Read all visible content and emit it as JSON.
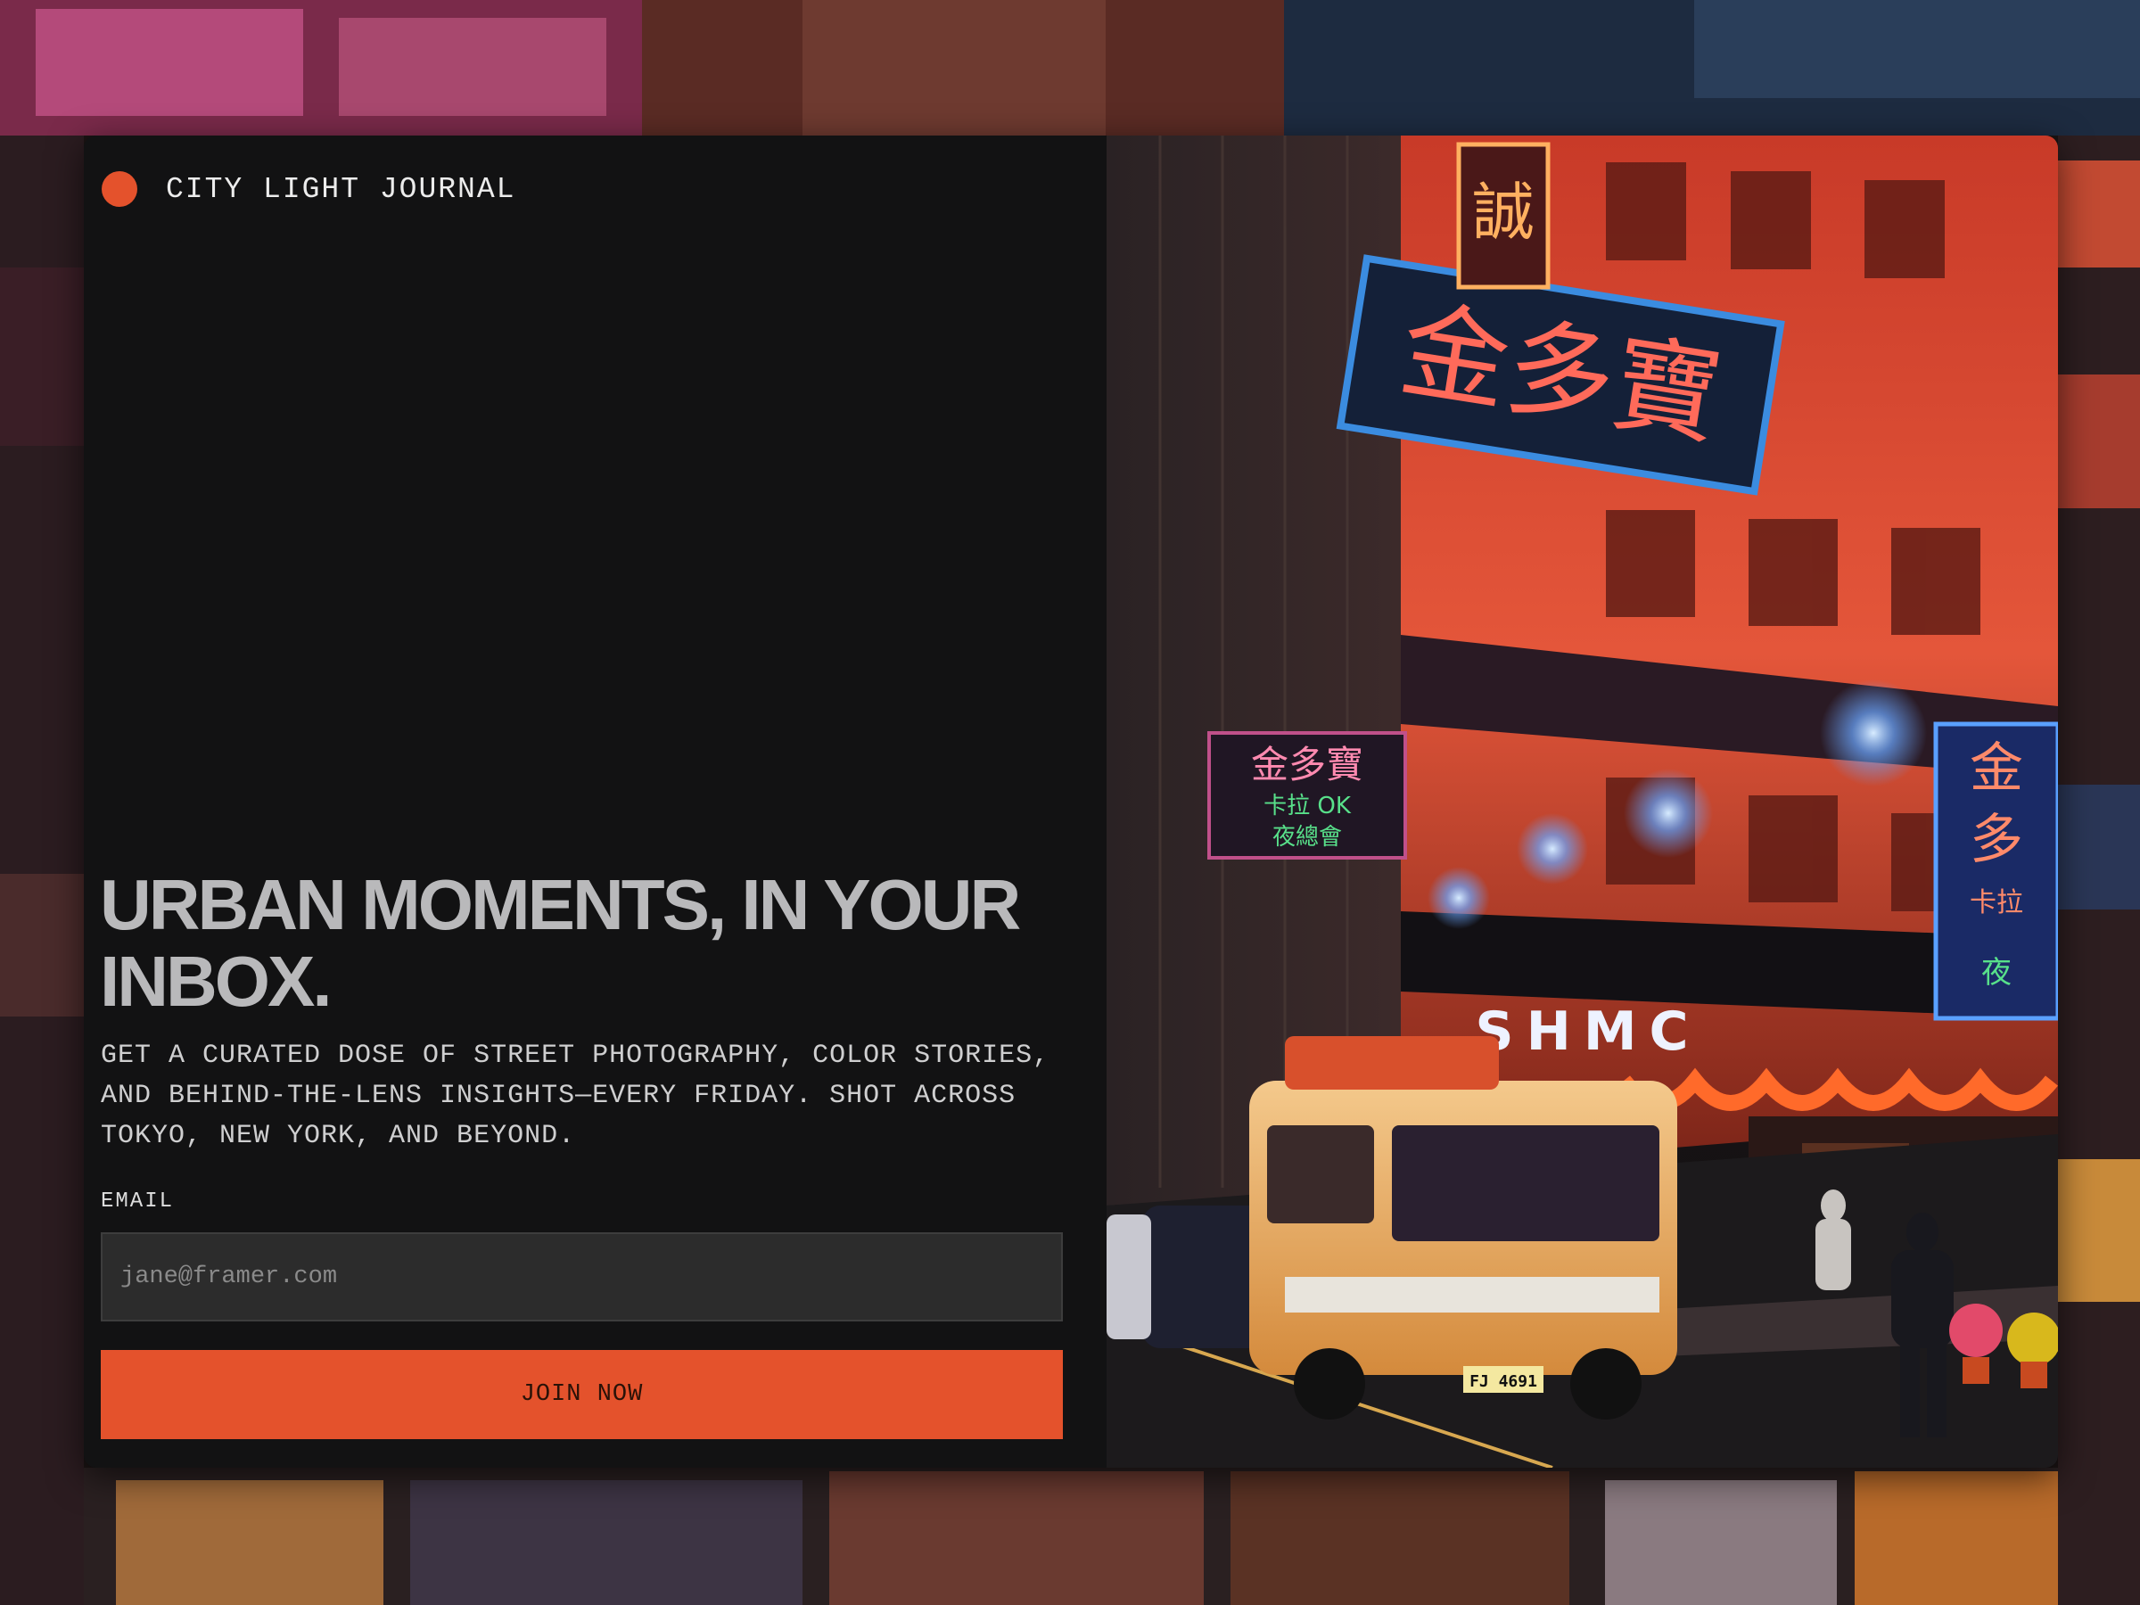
{
  "brand": {
    "name": "CITY LIGHT JOURNAL",
    "accent_color": "#e4522c"
  },
  "hero": {
    "headline": "URBAN MOMENTS, IN YOUR INBOX.",
    "subhead": "GET A CURATED DOSE OF STREET PHOTOGRAPHY, COLOR STORIES, AND BEHIND-THE-LENS INSIGHTS—EVERY FRIDAY. SHOT ACROSS TOKYO, NEW YORK, AND BEYOND."
  },
  "form": {
    "email_label": "EMAIL",
    "email_placeholder": "jane@framer.com",
    "email_value": "",
    "submit_label": "JOIN NOW"
  },
  "photo": {
    "sign_main": "金多寶",
    "sign_top": "誠",
    "sign_small_top": "金多寶",
    "sign_small_mid": "卡拉 OK",
    "sign_small_bot": "夜總會",
    "sign_right_1": "金",
    "sign_right_2": "多",
    "sign_right_3": "卡拉",
    "sign_right_4": "夜",
    "storefront": "SHMC",
    "plate": "FJ 4691"
  }
}
